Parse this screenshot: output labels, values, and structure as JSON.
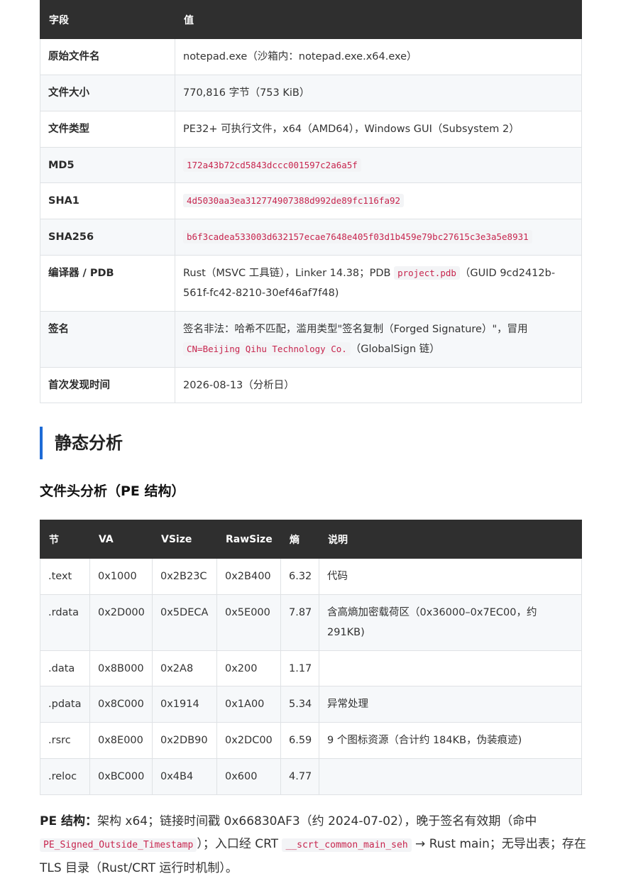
{
  "info_table": {
    "headers": {
      "field": "字段",
      "value": "值"
    },
    "rows": {
      "filename": {
        "key": "原始文件名",
        "value": "notepad.exe（沙箱内：notepad.exe.x64.exe）"
      },
      "filesize": {
        "key": "文件大小",
        "value": "770,816 字节（753 KiB）"
      },
      "filetype": {
        "key": "文件类型",
        "value": "PE32+ 可执行文件，x64（AMD64），Windows GUI（Subsystem 2）"
      },
      "md5": {
        "key": "MD5",
        "value": "172a43b72cd5843dccc001597c2a6a5f"
      },
      "sha1": {
        "key": "SHA1",
        "value": "4d5030aa3ea312774907388d992de89fc116fa92"
      },
      "sha256": {
        "key": "SHA256",
        "value": "b6f3cadea533003d632157ecae7648e405f03d1b459e79bc27615c3e3a5e8931"
      },
      "compiler": {
        "key": "编译器 / PDB",
        "value_prefix": "Rust（MSVC 工具链），Linker 14.38；PDB ",
        "pdb": "project.pdb",
        "value_suffix": "（GUID 9cd2412b-561f-fc42-8210-30ef46af7f48)"
      },
      "signature": {
        "key": "签名",
        "value_prefix": "签名非法：哈希不匹配，滥用类型\"签名复制（Forged Signature）\"，冒用 ",
        "cn": "CN=Beijing Qihu Technology Co.",
        "value_suffix": "（GlobalSign 链）"
      },
      "first_seen": {
        "key": "首次发现时间",
        "value": "2026-08-13（分析日）"
      }
    }
  },
  "section_heading": "静态分析",
  "subsection_heading": "文件头分析（PE 结构）",
  "sections_table": {
    "headers": [
      "节",
      "VA",
      "VSize",
      "RawSize",
      "熵",
      "说明"
    ],
    "rows": [
      {
        "name": ".text",
        "va": "0x1000",
        "vsize": "0x2B23C",
        "rawsize": "0x2B400",
        "entropy": "6.32",
        "desc": "代码"
      },
      {
        "name": ".rdata",
        "va": "0x2D000",
        "vsize": "0x5DECA",
        "rawsize": "0x5E000",
        "entropy": "7.87",
        "desc": "含高熵加密载荷区（0x36000–0x7EC00，约 291KB)"
      },
      {
        "name": ".data",
        "va": "0x8B000",
        "vsize": "0x2A8",
        "rawsize": "0x200",
        "entropy": "1.17",
        "desc": ""
      },
      {
        "name": ".pdata",
        "va": "0x8C000",
        "vsize": "0x1914",
        "rawsize": "0x1A00",
        "entropy": "5.34",
        "desc": "异常处理"
      },
      {
        "name": ".rsrc",
        "va": "0x8E000",
        "vsize": "0x2DB90",
        "rawsize": "0x2DC00",
        "entropy": "6.59",
        "desc": "9 个图标资源（合计约 184KB，伪装痕迹)"
      },
      {
        "name": ".reloc",
        "va": "0xBC000",
        "vsize": "0x4B4",
        "rawsize": "0x600",
        "entropy": "4.77",
        "desc": ""
      }
    ]
  },
  "pe_paragraph": {
    "label": "PE 结构",
    "colon": "：",
    "text1": "架构 x64；链接时间戳 0x66830AF3（约 2024-07-02），晚于签名有效期（命中 ",
    "code1": "PE_Signed_Outside_Timestamp",
    "text2": "）；入口经 CRT ",
    "code2": "__scrt_common_main_seh",
    "text3": " → Rust main；无导出表；存在 TLS 目录（Rust/CRT 运行时机制）。"
  }
}
